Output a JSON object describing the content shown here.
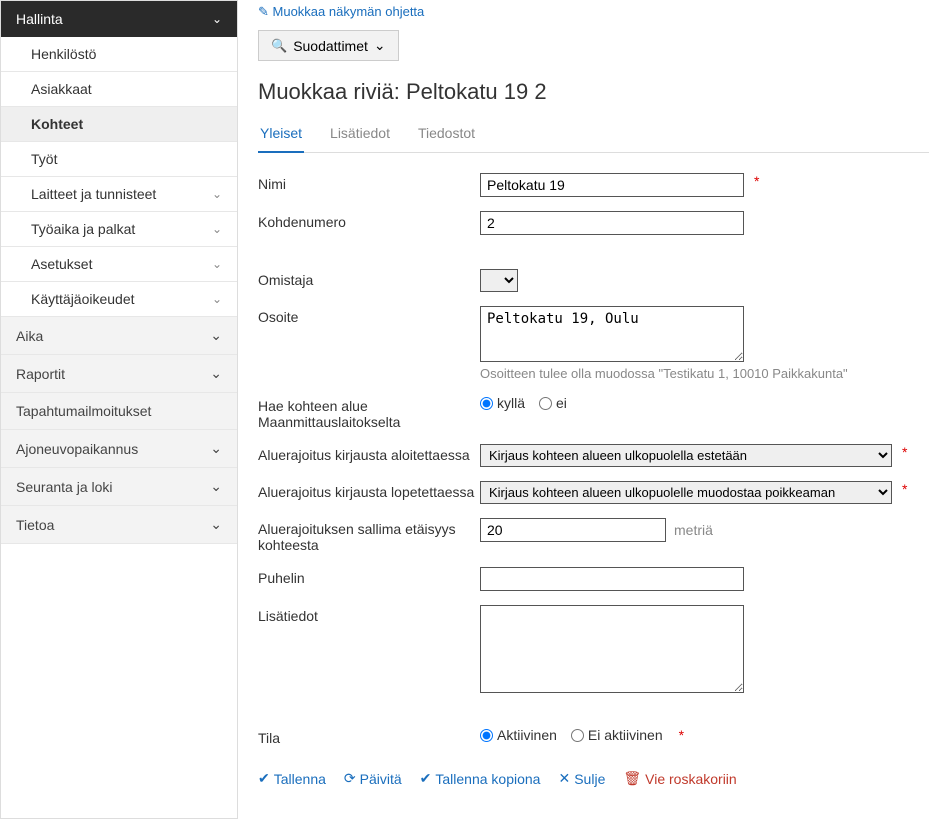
{
  "sidebar": {
    "header": "Hallinta",
    "items": [
      {
        "label": "Henkilöstö",
        "expandable": false,
        "active": false
      },
      {
        "label": "Asiakkaat",
        "expandable": false,
        "active": false
      },
      {
        "label": "Kohteet",
        "expandable": false,
        "active": true
      },
      {
        "label": "Työt",
        "expandable": false,
        "active": false
      },
      {
        "label": "Laitteet ja tunnisteet",
        "expandable": true,
        "active": false
      },
      {
        "label": "Työaika ja palkat",
        "expandable": true,
        "active": false
      },
      {
        "label": "Asetukset",
        "expandable": true,
        "active": false
      },
      {
        "label": "Käyttäjäoikeudet",
        "expandable": true,
        "active": false
      }
    ],
    "groups": [
      {
        "label": "Aika"
      },
      {
        "label": "Raportit"
      },
      {
        "label": "Tapahtumailmoitukset"
      },
      {
        "label": "Ajoneuvopaikannus"
      },
      {
        "label": "Seuranta ja loki"
      },
      {
        "label": "Tietoa"
      }
    ]
  },
  "top_link": "Muokkaa näkymän ohjetta",
  "filter_button": "Suodattimet",
  "page_title": "Muokkaa riviä: Peltokatu 19 2",
  "tabs": [
    {
      "label": "Yleiset",
      "active": true
    },
    {
      "label": "Lisätiedot",
      "active": false
    },
    {
      "label": "Tiedostot",
      "active": false
    }
  ],
  "form": {
    "name": {
      "label": "Nimi",
      "value": "Peltokatu 19"
    },
    "target_number": {
      "label": "Kohdenumero",
      "value": "2"
    },
    "owner": {
      "label": "Omistaja",
      "value": ""
    },
    "address": {
      "label": "Osoite",
      "value": "Peltokatu 19, Oulu",
      "hint": "Osoitteen tulee olla muodossa \"Testikatu 1, 10010 Paikkakunta\""
    },
    "fetch_area": {
      "label": "Hae kohteen alue Maanmittauslaitokselta",
      "yes": "kyllä",
      "no": "ei",
      "value": "yes"
    },
    "limit_start": {
      "label": "Aluerajoitus kirjausta aloitettaessa",
      "value": "Kirjaus kohteen alueen ulkopuolella estetään"
    },
    "limit_end": {
      "label": "Aluerajoitus kirjausta lopetettaessa",
      "value": "Kirjaus kohteen alueen ulkopuolelle muodostaa poikkeaman"
    },
    "distance": {
      "label": "Aluerajoituksen sallima etäisyys kohteesta",
      "value": "20",
      "unit": "metriä"
    },
    "phone": {
      "label": "Puhelin",
      "value": ""
    },
    "info": {
      "label": "Lisätiedot",
      "value": ""
    },
    "status": {
      "label": "Tila",
      "active": "Aktiivinen",
      "inactive": "Ei aktiivinen",
      "value": "active"
    }
  },
  "actions": {
    "save": "Tallenna",
    "refresh": "Päivitä",
    "save_copy": "Tallenna kopiona",
    "close": "Sulje",
    "trash": "Vie roskakoriin"
  }
}
